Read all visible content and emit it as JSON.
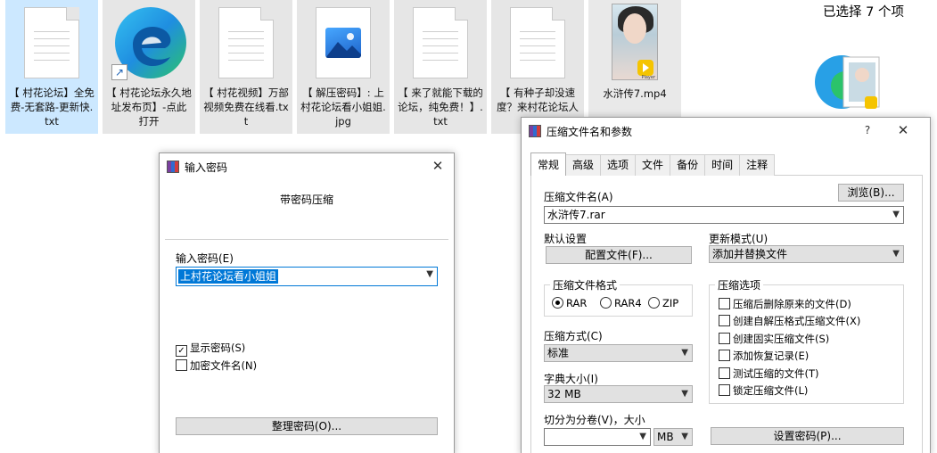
{
  "explorer": {
    "files": [
      {
        "label": "【 村花论坛】全免费-无套路-更新快.txt",
        "type": "txt",
        "icon": "text-file-icon",
        "selected": true
      },
      {
        "label": "【 村花论坛永久地址发布页】-点此打开",
        "type": "shortcut",
        "icon": "edge-shortcut-icon",
        "selected": false
      },
      {
        "label": "【 村花视频】万部视频免费在线看.txt",
        "type": "txt",
        "icon": "text-file-icon",
        "selected": false
      },
      {
        "label": "【 解压密码】: 上村花论坛看小姐姐.jpg",
        "type": "jpg",
        "icon": "image-file-icon",
        "selected": false
      },
      {
        "label": "【 来了就能下载的论坛，纯免费！】.txt",
        "type": "txt",
        "icon": "text-file-icon",
        "selected": false
      },
      {
        "label": "【 有种子却没速度？来村花论坛人工…",
        "type": "txt",
        "icon": "text-file-icon",
        "selected": false
      },
      {
        "label": "水浒传7.mp4",
        "type": "mp4",
        "icon": "video-thumbnail-icon",
        "selected": false
      }
    ],
    "mp4_badge": "Player",
    "details": {
      "selected_text": "已选择 7 个项"
    }
  },
  "password_dialog": {
    "title": "输入密码",
    "heading": "带密码压缩",
    "input_label": "输入密码(E)",
    "password_value": "上村花论坛看小姐姐",
    "show_password_label": "显示密码(S)",
    "show_password_checked": true,
    "encrypt_names_label": "加密文件名(N)",
    "encrypt_names_checked": false,
    "organize_button": "整理密码(O)..."
  },
  "archive_dialog": {
    "title": "压缩文件名和参数",
    "help": "?",
    "tabs": [
      "常规",
      "高级",
      "选项",
      "文件",
      "备份",
      "时间",
      "注释"
    ],
    "active_tab": 0,
    "archive_name_label": "压缩文件名(A)",
    "browse_button": "浏览(B)...",
    "archive_name_value": "水浒传7.rar",
    "default_settings_label": "默认设置",
    "profiles_button": "配置文件(F)...",
    "update_mode_label": "更新模式(U)",
    "update_mode_value": "添加并替换文件",
    "format_group": "压缩文件格式",
    "formats": [
      {
        "label": "RAR",
        "checked": true
      },
      {
        "label": "RAR4",
        "checked": false
      },
      {
        "label": "ZIP",
        "checked": false
      }
    ],
    "options_group": "压缩选项",
    "options": [
      {
        "label": "压缩后删除原来的文件(D)",
        "checked": false
      },
      {
        "label": "创建自解压格式压缩文件(X)",
        "checked": false
      },
      {
        "label": "创建固实压缩文件(S)",
        "checked": false
      },
      {
        "label": "添加恢复记录(E)",
        "checked": false
      },
      {
        "label": "测试压缩的文件(T)",
        "checked": false
      },
      {
        "label": "锁定压缩文件(L)",
        "checked": false
      }
    ],
    "method_label": "压缩方式(C)",
    "method_value": "标准",
    "dict_label": "字典大小(I)",
    "dict_value": "32 MB",
    "split_label": "切分为分卷(V)，大小",
    "split_value": "",
    "split_unit": "MB",
    "set_password_button": "设置密码(P)..."
  }
}
